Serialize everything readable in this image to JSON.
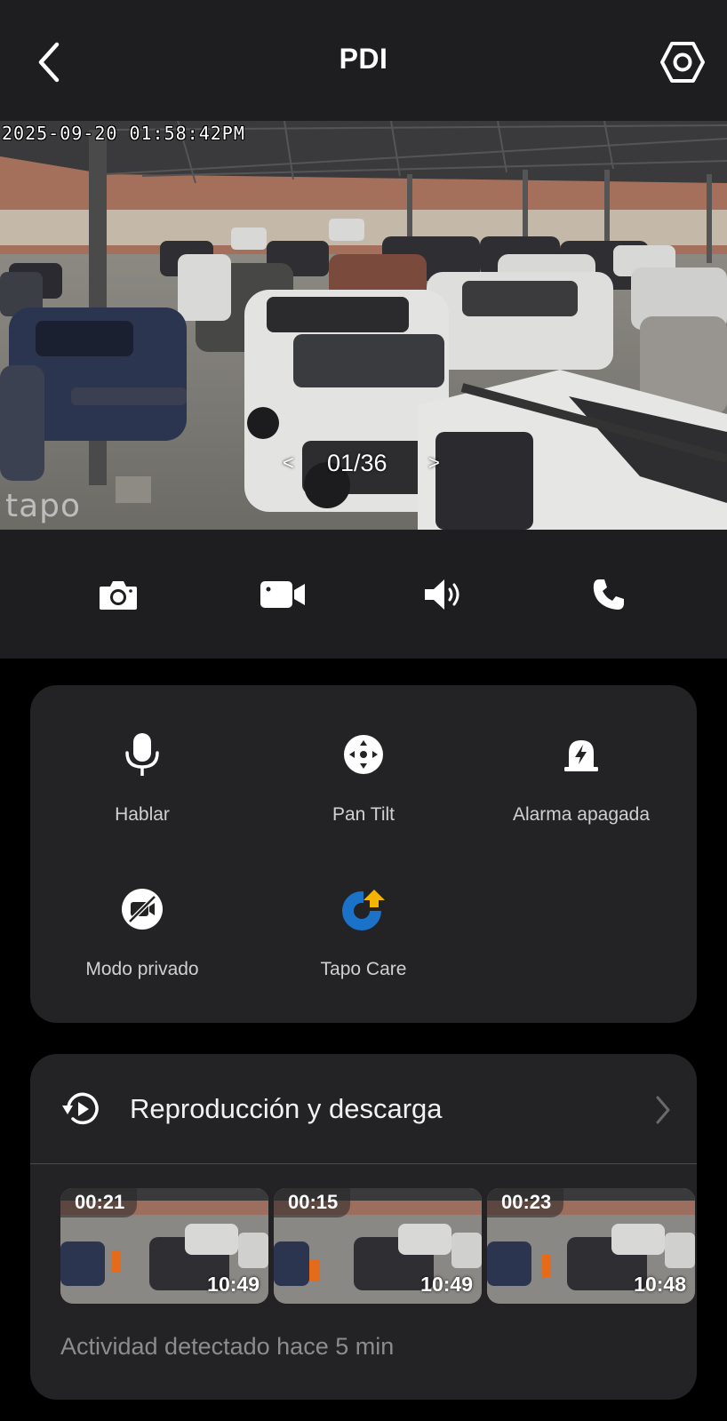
{
  "header": {
    "title": "PDI",
    "back_icon": "chevron-left-icon",
    "settings_icon": "hexagon-settings-icon"
  },
  "live_view": {
    "timestamp": "2025-09-20 01:58:42PM",
    "watermark": "tapo",
    "pager": {
      "prev": "<",
      "count": "01/36",
      "next": ">"
    }
  },
  "controls": [
    {
      "icon": "camera-icon",
      "name": "snapshot"
    },
    {
      "icon": "video-camera-icon",
      "name": "record"
    },
    {
      "icon": "speaker-icon",
      "name": "audio"
    },
    {
      "icon": "phone-icon",
      "name": "call"
    }
  ],
  "actions": [
    {
      "label": "Hablar",
      "icon": "microphone-icon"
    },
    {
      "label": "Pan Tilt",
      "icon": "pan-tilt-icon"
    },
    {
      "label": "Alarma apagada",
      "icon": "alarm-icon"
    },
    {
      "label": "Modo privado",
      "icon": "camera-off-icon"
    },
    {
      "label": "Tapo Care",
      "icon": "tapo-care-icon"
    }
  ],
  "playback": {
    "title": "Reproducción y descarga",
    "icon": "history-icon",
    "clips": [
      {
        "duration": "00:21",
        "time": "10:49"
      },
      {
        "duration": "00:15",
        "time": "10:49"
      },
      {
        "duration": "00:23",
        "time": "10:48"
      }
    ],
    "activity": "Actividad detectado hace 5 min"
  },
  "colors": {
    "bar_bg": "#1e1e20",
    "card_bg": "#232325",
    "accent_blue": "#1a73c9",
    "accent_yellow": "#f5b400"
  }
}
